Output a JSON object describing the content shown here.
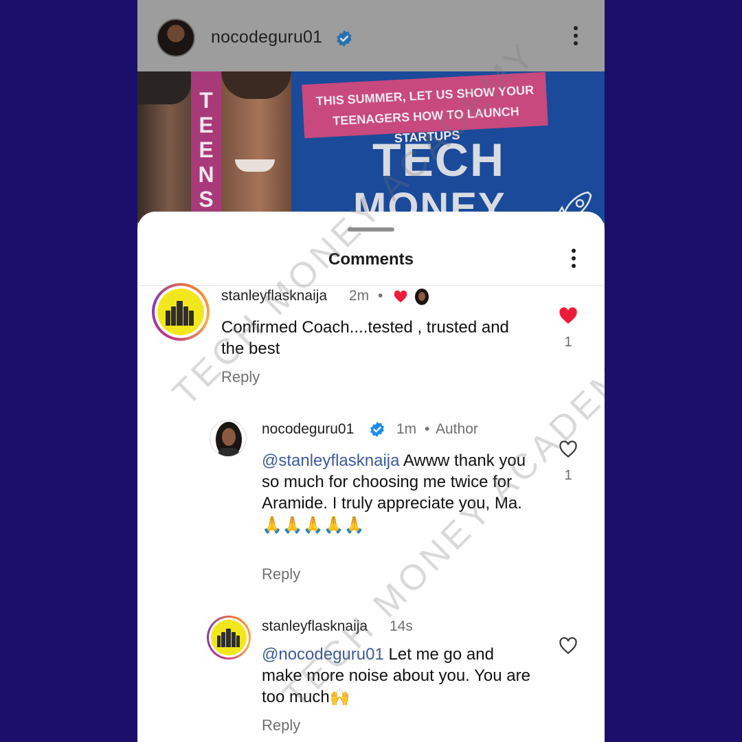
{
  "post_header": {
    "username": "nocodeguru01",
    "verified_icon": "verified-badge-icon",
    "more_icon": "more-vertical-icon"
  },
  "post_image": {
    "side_word": "TEENS",
    "banner": "THIS SUMMER, LET US SHOW YOUR TEENAGERS HOW TO LAUNCH STARTUPS",
    "headline_1": "TECH",
    "headline_2": "MONEY"
  },
  "sheet": {
    "title": "Comments",
    "more_icon": "more-vertical-icon"
  },
  "comments": [
    {
      "username": "stanleyflasknaija",
      "time": "2m",
      "dot": "•",
      "text": "Confirmed Coach....tested , trusted and the best",
      "reply": "Reply",
      "liked": true,
      "like_count": "1",
      "liked_by_author": true
    },
    {
      "username": "nocodeguru01",
      "verified": true,
      "time": "1m",
      "dot": "•",
      "author_label": "Author",
      "mention": "@stanleyflasknaija",
      "text": " Awww thank you so much for choosing me twice for Aramide. I truly appreciate you, Ma. ",
      "emoji": "🙏🙏🙏🙏🙏",
      "reply": "Reply",
      "liked": false,
      "like_count": "1"
    },
    {
      "username": "stanleyflasknaija",
      "time": "14s",
      "mention": "@nocodeguru01",
      "text": " Let me go and make more noise about you. You are too much",
      "emoji": "🙌",
      "reply": "Reply",
      "liked": false
    }
  ],
  "watermark": "TECH MONEY ACADEMY",
  "colors": {
    "background": "#1b0f6b",
    "heart_red": "#ed1c3a",
    "mention_blue": "#3d5a9a",
    "verified_blue": "#1d8cf0"
  }
}
